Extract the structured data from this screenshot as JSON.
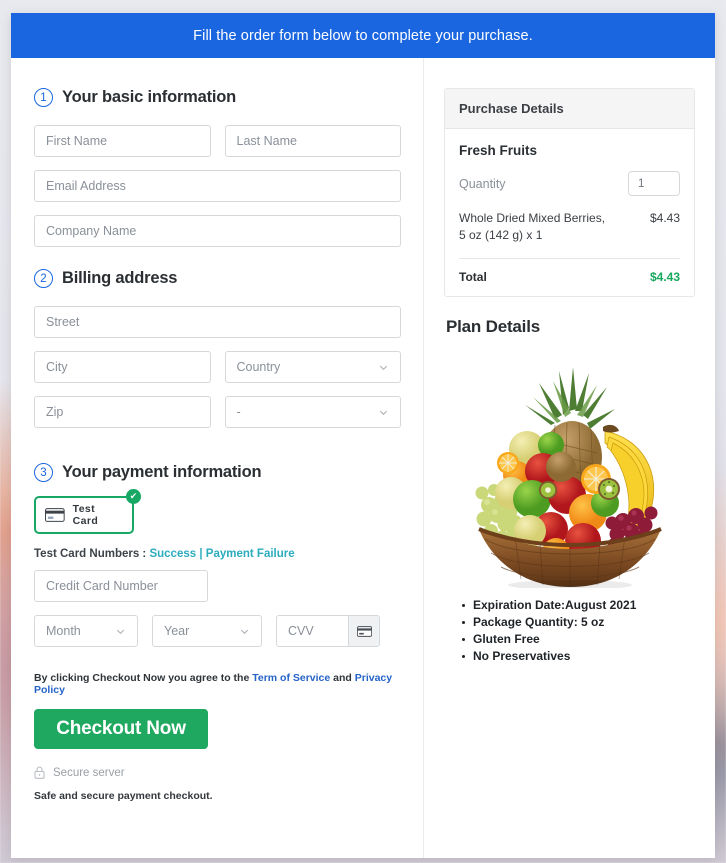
{
  "banner": {
    "text": "Fill the order form below to complete your purchase."
  },
  "sections": {
    "basic": {
      "number": "1",
      "title": "Your basic information"
    },
    "billing": {
      "number": "2",
      "title": "Billing address"
    },
    "payment": {
      "number": "3",
      "title": "Your payment information"
    }
  },
  "fields": {
    "first_name": "First Name",
    "last_name": "Last Name",
    "email": "Email Address",
    "company": "Company Name",
    "street": "Street",
    "city": "City",
    "country": "Country",
    "zip": "Zip",
    "state": "-",
    "credit_card_number": "Credit Card Number",
    "month": "Month",
    "year": "Year",
    "cvv": "CVV"
  },
  "payment": {
    "card_option_label": "Test  Card",
    "card_icon": "credit-card-icon",
    "selected_badge": "✔",
    "test_numbers_label": "Test Card Numbers :",
    "success_link": "Success",
    "separator": "|",
    "failure_link": "Payment Failure",
    "link_color": "#2bacbd"
  },
  "footer": {
    "terms_prefix": "By clicking Checkout Now you agree to the",
    "terms_link": "Term of Service",
    "terms_and": "and",
    "privacy_link": "Privacy Policy",
    "checkout_button": "Checkout Now",
    "secure_server": "Secure server",
    "lock_icon": "lock-icon",
    "safe_note": "Safe and secure payment checkout."
  },
  "purchase": {
    "header": "Purchase Details",
    "product_name": "Fresh Fruits",
    "quantity_label": "Quantity",
    "quantity_value": "1",
    "item_description": "Whole Dried Mixed Berries, 5 oz (142 g) x 1",
    "item_price": "$4.43",
    "total_label": "Total",
    "total_value": "$4.43",
    "total_color": "#18a85d"
  },
  "plan": {
    "title": "Plan Details",
    "image_name": "fruit-basket-photo",
    "details": [
      "Expiration Date:August 2021",
      "Package Quantity: 5 oz",
      "Gluten Free",
      "No Preservatives"
    ]
  },
  "colors": {
    "banner_blue": "#1a66e0",
    "accent_green": "#1fa85f",
    "card_border_green": "#16a864"
  }
}
